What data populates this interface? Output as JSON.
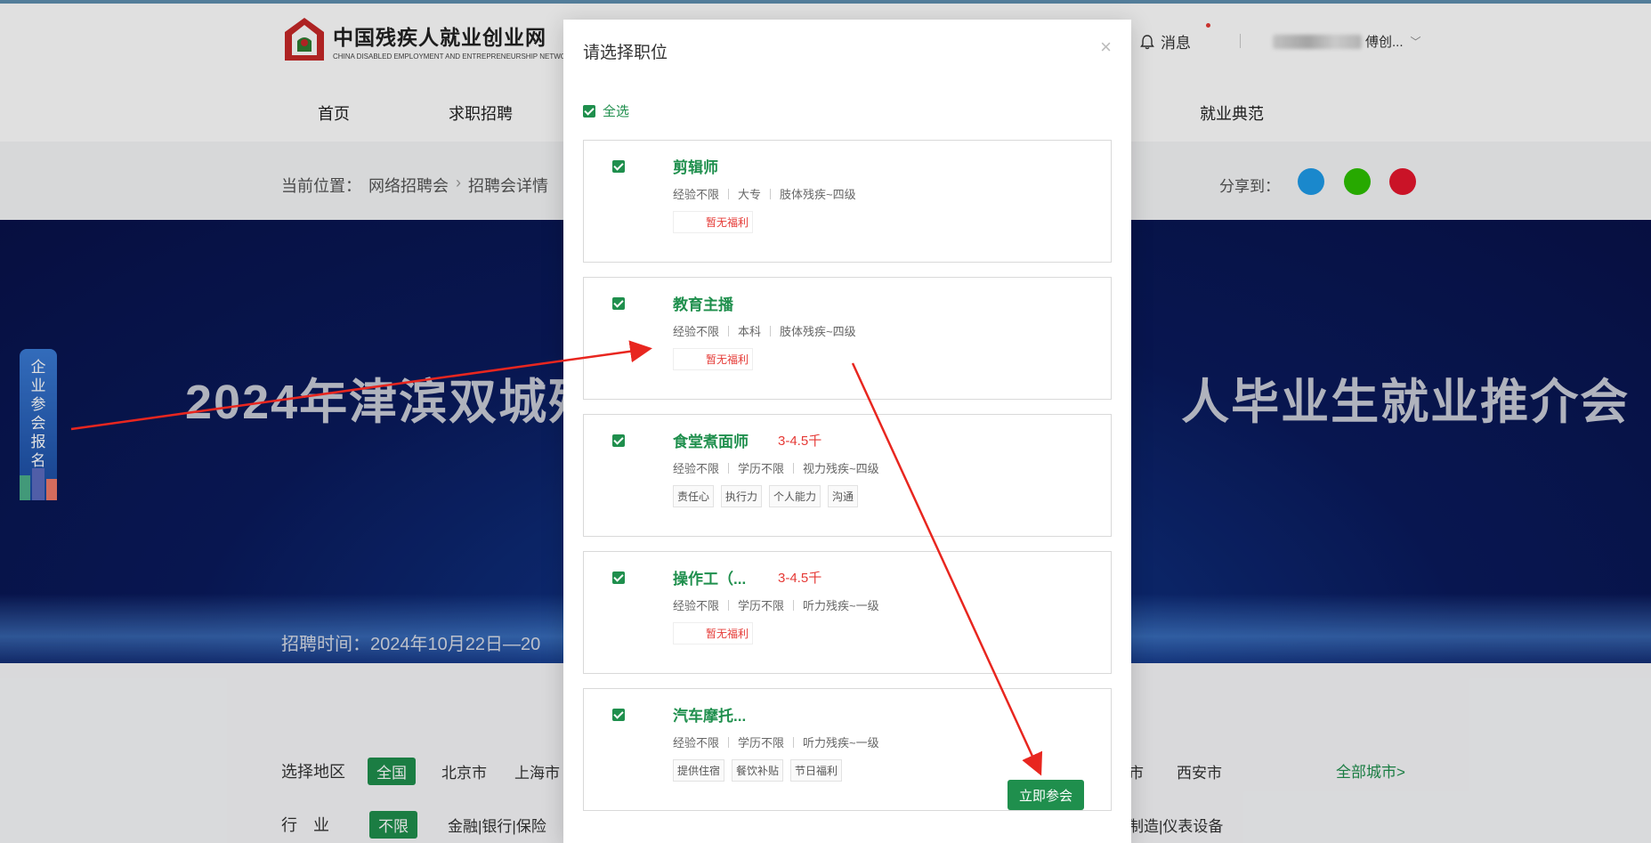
{
  "site": {
    "logo_cn": "中国残疾人就业创业网",
    "logo_en": "CHINA DISABLED EMPLOYMENT AND ENTREPRENEURSHIP NETWORK",
    "messages_label": "消息",
    "user_name_visible": "傅创..."
  },
  "nav": {
    "items": [
      {
        "label": "首页"
      },
      {
        "label": "求职招聘"
      },
      {
        "label": "就业典范"
      }
    ]
  },
  "breadcrumb": {
    "prefix": "当前位置：",
    "items": [
      {
        "label": "网络招聘会"
      },
      {
        "label": "招聘会详情"
      }
    ]
  },
  "share": {
    "label": "分享到：",
    "icons": [
      "qq-icon",
      "wechat-icon",
      "weibo-icon"
    ],
    "colors": [
      "#1e9be9",
      "#2dc100",
      "#e6162d"
    ]
  },
  "banner": {
    "title_left": "2024年津滨双城残",
    "title_right": "人毕业生就业推介会",
    "time_text": "招聘时间：2024年10月22日—20"
  },
  "side_badge": {
    "chars": [
      "企",
      "业",
      "参",
      "会",
      "报",
      "名"
    ]
  },
  "filters": {
    "region_label": "选择地区",
    "regions": [
      {
        "label": "全国",
        "active": true
      },
      {
        "label": "北京市",
        "active": false
      },
      {
        "label": "上海市",
        "active": false
      },
      {
        "label": "市",
        "active": false
      },
      {
        "label": "西安市",
        "active": false
      }
    ],
    "all_cities": "全部城市>",
    "industry_label": "行　业",
    "industries": [
      {
        "label": "不限",
        "active": true
      },
      {
        "label": "金融|银行|保险",
        "active": false
      },
      {
        "label": "制造|仪表设备",
        "active": false
      }
    ]
  },
  "modal": {
    "title": "请选择职位",
    "close": "×",
    "select_all": "全选",
    "submit": "立即参会",
    "jobs": [
      {
        "name": "剪辑师",
        "salary": "",
        "meta": [
          "经验不限",
          "大专",
          "肢体残疾~四级"
        ],
        "tags": [
          "暂无福利"
        ],
        "no_benefit": true
      },
      {
        "name": "教育主播",
        "salary": "",
        "meta": [
          "经验不限",
          "本科",
          "肢体残疾~四级"
        ],
        "tags": [
          "暂无福利"
        ],
        "no_benefit": true
      },
      {
        "name": "食堂煮面师",
        "salary": "3-4.5千",
        "meta": [
          "经验不限",
          "学历不限",
          "视力残疾~四级"
        ],
        "tags": [
          "责任心",
          "执行力",
          "个人能力",
          "沟通"
        ],
        "no_benefit": false
      },
      {
        "name": "操作工（...",
        "salary": "3-4.5千",
        "meta": [
          "经验不限",
          "学历不限",
          "听力残疾~一级"
        ],
        "tags": [
          "暂无福利"
        ],
        "no_benefit": true
      },
      {
        "name": "汽车摩托...",
        "salary": "",
        "meta": [
          "经验不限",
          "学历不限",
          "听力残疾~一级"
        ],
        "tags": [
          "提供住宿",
          "餐饮补贴",
          "节日福利"
        ],
        "no_benefit": false
      }
    ]
  },
  "colors": {
    "brand_green": "#1f8f4d",
    "salary_red": "#e53935",
    "annotation_red": "#e8261f"
  }
}
